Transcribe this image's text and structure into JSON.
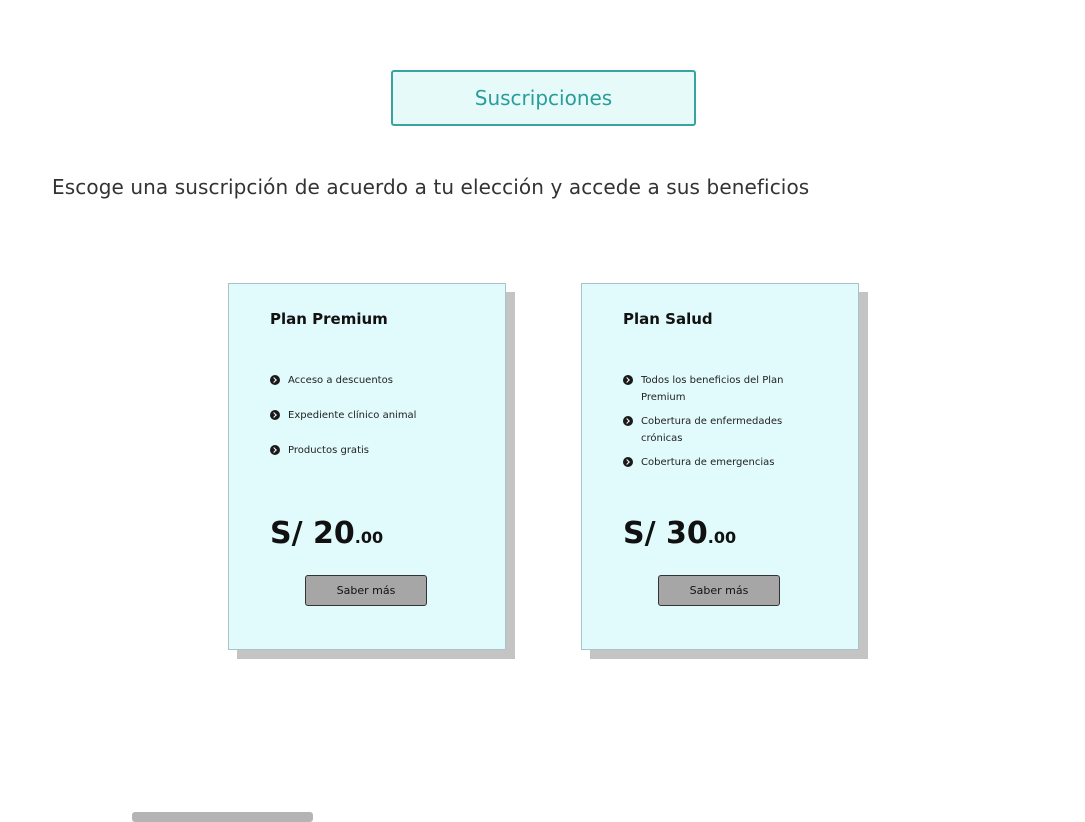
{
  "header": {
    "title": "Suscripciones",
    "subtitle": "Escoge una suscripción de acuerdo a tu elección y accede a sus beneficios"
  },
  "plans": [
    {
      "name": "Plan Premium",
      "benefits": [
        "Acceso a descuentos",
        "Expediente clínico animal",
        "Productos gratis"
      ],
      "price_main": "S/ 20",
      "price_cents": ".00",
      "button_label": "Saber más"
    },
    {
      "name": "Plan Salud",
      "benefits": [
        "Todos los beneficios del Plan Premium",
        "Cobertura de enfermedades crónicas",
        "Cobertura de emergencias"
      ],
      "price_main": "S/ 30",
      "price_cents": ".00",
      "button_label": "Saber más"
    }
  ],
  "colors": {
    "accent": "#2a9d9a",
    "card_background": "#e1fafb",
    "button_background": "#a6a6a6"
  },
  "icons": {
    "benefit_bullet": "chevron-right-circle-icon"
  }
}
